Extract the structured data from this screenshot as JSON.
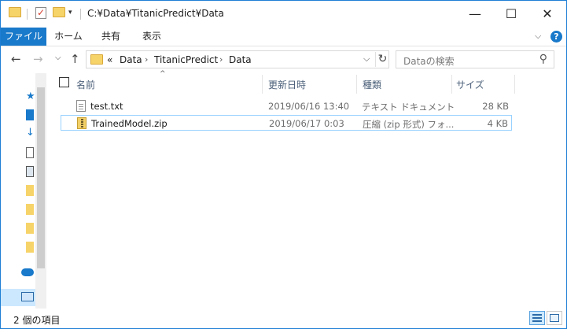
{
  "window": {
    "title": "C:¥Data¥TitanicPredict¥Data",
    "minimize_glyph": "—",
    "maximize_glyph": "☐",
    "close_glyph": "✕"
  },
  "ribbon": {
    "tabs": [
      "ファイル",
      "ホーム",
      "共有",
      "表示"
    ],
    "expand_glyph": "⌵",
    "help_glyph": "?"
  },
  "nav": {
    "back_glyph": "←",
    "forward_glyph": "→",
    "recent_glyph": "⌵",
    "up_glyph": "↑"
  },
  "address": {
    "overflow": "«",
    "crumbs": [
      "Data",
      "TitanicPredict",
      "Data"
    ],
    "separator": "›",
    "dropdown_glyph": "⌵",
    "refresh_glyph": "↻"
  },
  "search": {
    "placeholder": "Dataの検索",
    "icon_glyph": "⚲"
  },
  "columns": {
    "name": "名前",
    "date": "更新日時",
    "type": "種類",
    "size": "サイズ",
    "sort_glyph": "^"
  },
  "files": [
    {
      "name": "test.txt",
      "date": "2019/06/16 13:40",
      "type": "テキスト ドキュメント",
      "size": "28 KB",
      "icon": "text-file-icon"
    },
    {
      "name": "TrainedModel.zip",
      "date": "2019/06/17 0:03",
      "type": "圧縮 (zip 形式) フォ...",
      "size": "4 KB",
      "icon": "zip-file-icon"
    }
  ],
  "status": {
    "item_count": "2 個の項目"
  },
  "colors": {
    "accent": "#1979ca",
    "selection_border": "#99d1ff",
    "header_text": "#4c607a"
  }
}
